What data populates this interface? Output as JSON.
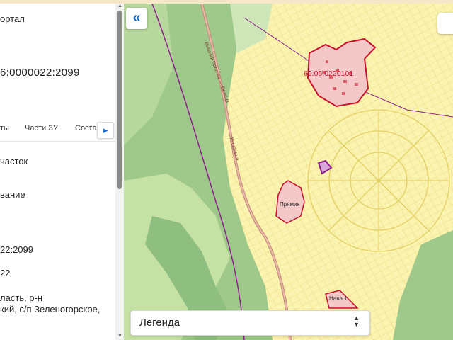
{
  "sidebar": {
    "portal_fragment": "ортал",
    "cadastral_fragment": "6:0000022:2099",
    "tabs": [
      "ты",
      "Части ЗУ",
      "Соста"
    ],
    "fields": [
      "часток",
      "вание",
      "22:2099",
      "22",
      "ласть, р-н",
      "кий, с/п Зеленогорское,"
    ]
  },
  "map": {
    "collapse_icon": "«",
    "labels": {
      "quarter": "69:06:0220101",
      "road_1": "Вышний Волочёк — Бежецк",
      "road_2": "Кушалино",
      "settlement_1": "Прямик",
      "settlement_2": "Нава 1"
    },
    "colors": {
      "parcel_fill": "#fdf5b4",
      "parcel_line": "#e9d874",
      "forest": "#9ec98a",
      "quarter_border": "#c8102e",
      "selected_parcel": "#8d1f8d",
      "road": "#c48a7a"
    }
  },
  "legend": {
    "label": "Легенда"
  }
}
